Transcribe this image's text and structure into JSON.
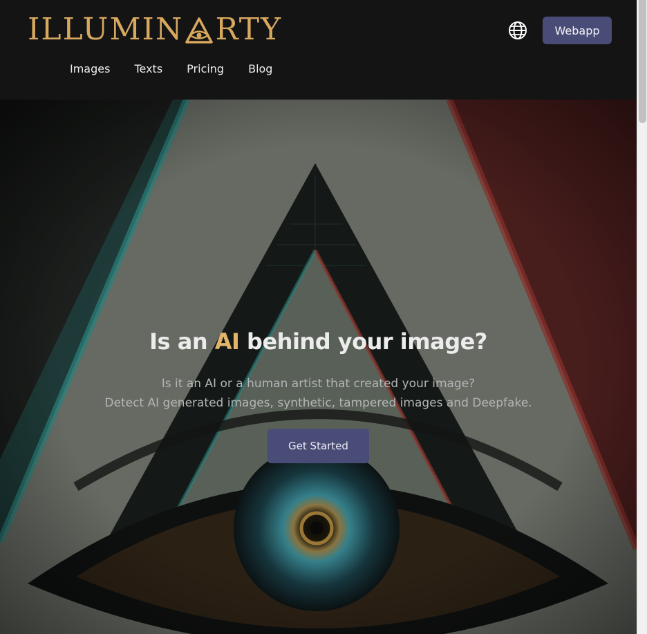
{
  "header": {
    "logo_left": "ILLUMIN",
    "logo_right": "RTY",
    "webapp_label": "Webapp"
  },
  "nav": {
    "items": [
      "Images",
      "Texts",
      "Pricing",
      "Blog"
    ]
  },
  "hero": {
    "title_pre": "Is an ",
    "title_accent": "AI",
    "title_post": " behind your image?",
    "subtitle_line1": "Is it an AI or a human artist that created your image?",
    "subtitle_line2": "Detect AI generated images, synthetic, tampered images and Deepfake.",
    "cta_label": "Get Started"
  },
  "icons": {
    "globe": "globe-icon",
    "logo_eye": "eye-triangle-icon"
  },
  "colors": {
    "brand_gold": "#d8a85f",
    "button_bg": "#4a4c78",
    "header_bg": "#141414"
  }
}
